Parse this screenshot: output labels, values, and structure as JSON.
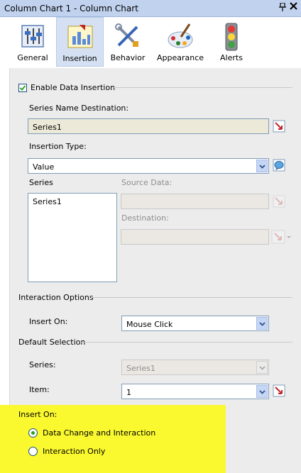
{
  "window": {
    "title": "Column Chart 1 - Column Chart",
    "pin_glyph": "ᵪ",
    "close_glyph": "×"
  },
  "tabs": [
    {
      "label": "General",
      "icon": "general-icon",
      "active": false
    },
    {
      "label": "Insertion",
      "icon": "insertion-icon",
      "active": true
    },
    {
      "label": "Behavior",
      "icon": "behavior-icon",
      "active": false
    },
    {
      "label": "Appearance",
      "icon": "appearance-icon",
      "active": false
    },
    {
      "label": "Alerts",
      "icon": "alerts-icon",
      "active": false
    }
  ],
  "insertion": {
    "enable_label": "Enable Data Insertion",
    "enable_checked": true,
    "series_name_dest_label": "Series Name Destination:",
    "series_name_dest_value": "Series1",
    "insertion_type_label": "Insertion Type:",
    "insertion_type_value": "Value",
    "series_label": "Series",
    "series_items": [
      "Series1"
    ],
    "source_data_label": "Source Data:",
    "destination_label": "Destination:"
  },
  "interaction": {
    "section_label": "Interaction Options",
    "insert_on_label": "Insert On:",
    "insert_on_value": "Mouse Click"
  },
  "default_selection": {
    "section_label": "Default Selection",
    "series_label": "Series:",
    "series_value": "Series1",
    "item_label": "Item:",
    "item_value": "1"
  },
  "insert_on_options": {
    "label": "Insert On:",
    "options": [
      {
        "label": "Data Change and Interaction",
        "selected": true
      },
      {
        "label": "Interaction Only",
        "selected": false
      }
    ],
    "highlight_color": "#faf82e"
  },
  "colors": {
    "accent_red": "#c0242a",
    "titlebar": "#c1d2ee",
    "active_tab": "#d5e1f2"
  }
}
